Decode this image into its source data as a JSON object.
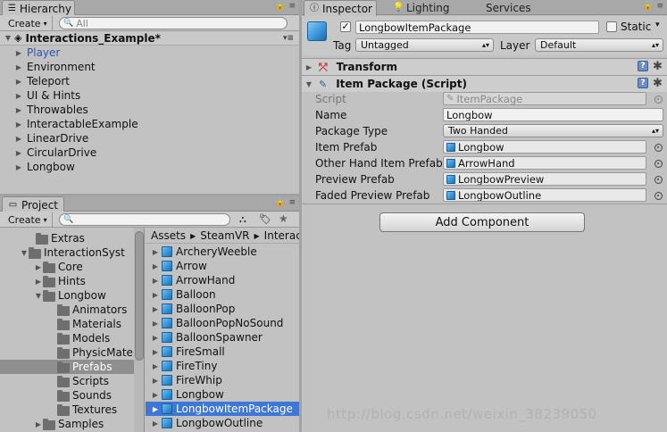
{
  "hierarchy": {
    "tab_label": "Hierarchy",
    "create_label": "Create",
    "search_placeholder": "All",
    "scene_name": "Interactions_Example*",
    "items": [
      {
        "label": "Player",
        "highlight": true
      },
      {
        "label": "Environment"
      },
      {
        "label": "Teleport"
      },
      {
        "label": "UI & Hints"
      },
      {
        "label": "Throwables"
      },
      {
        "label": "InteractableExample"
      },
      {
        "label": "LinearDrive"
      },
      {
        "label": "CircularDrive"
      },
      {
        "label": "Longbow"
      }
    ]
  },
  "project": {
    "tab_label": "Project",
    "create_label": "Create",
    "tree": [
      {
        "label": "Extras",
        "expanded": false,
        "arrow": false
      },
      {
        "label": "InteractionSyst",
        "expanded": true,
        "arrow": true
      },
      {
        "label": "Core",
        "expanded": false,
        "arrow": true
      },
      {
        "label": "Hints",
        "expanded": false,
        "arrow": true
      },
      {
        "label": "Longbow",
        "expanded": true,
        "arrow": true
      },
      {
        "label": "Animators",
        "arrow": false
      },
      {
        "label": "Materials",
        "arrow": false
      },
      {
        "label": "Models",
        "arrow": false
      },
      {
        "label": "PhysicMate",
        "arrow": false
      },
      {
        "label": "Prefabs",
        "arrow": false,
        "selected": true
      },
      {
        "label": "Scripts",
        "arrow": false
      },
      {
        "label": "Sounds",
        "arrow": false
      },
      {
        "label": "Textures",
        "arrow": false
      },
      {
        "label": "Samples",
        "expanded": false,
        "arrow": true
      }
    ],
    "breadcrumb": [
      "Assets",
      "SteamVR",
      "Interac"
    ],
    "assets": [
      {
        "label": "ArcheryWeeble"
      },
      {
        "label": "Arrow"
      },
      {
        "label": "ArrowHand"
      },
      {
        "label": "Balloon"
      },
      {
        "label": "BalloonPop"
      },
      {
        "label": "BalloonPopNoSound"
      },
      {
        "label": "BalloonSpawner"
      },
      {
        "label": "FireSmall"
      },
      {
        "label": "FireTiny"
      },
      {
        "label": "FireWhip"
      },
      {
        "label": "Longbow"
      },
      {
        "label": "LongbowItemPackage",
        "selected": true
      },
      {
        "label": "LongbowOutline"
      }
    ]
  },
  "inspector": {
    "tabs": [
      "Inspector",
      "Lighting",
      "Services"
    ],
    "object_name": "LongbowItemPackage",
    "static_label": "Static",
    "tag_label": "Tag",
    "tag_value": "Untagged",
    "layer_label": "Layer",
    "layer_value": "Default",
    "transform_label": "Transform",
    "component_label": "Item Package (Script)",
    "fields": [
      {
        "label": "Script",
        "value": "ItemPackage",
        "kind": "script"
      },
      {
        "label": "Name",
        "value": "Longbow",
        "kind": "text"
      },
      {
        "label": "Package Type",
        "value": "Two Handed",
        "kind": "dropdown"
      },
      {
        "label": "Item Prefab",
        "value": "Longbow",
        "kind": "object"
      },
      {
        "label": "Other Hand Item Prefab",
        "value": "ArrowHand",
        "kind": "object"
      },
      {
        "label": "Preview Prefab",
        "value": "LongbowPreview",
        "kind": "object"
      },
      {
        "label": "Faded Preview Prefab",
        "value": "LongbowOutline",
        "kind": "object"
      }
    ],
    "add_component_label": "Add Component"
  },
  "watermark": "http://blog.csdn.net/weixin_38239050",
  "colors": {
    "selection": "#3d77d8",
    "panel": "#c2c2c2",
    "highlight_text": "#2b55b0"
  }
}
